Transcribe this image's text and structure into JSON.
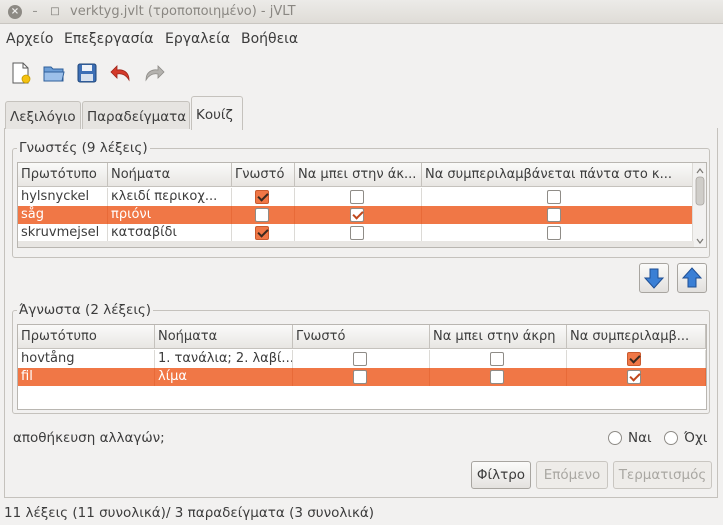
{
  "window": {
    "title": "verktyg.jvlt (τροποποιημένο) - jVLT",
    "close_glyph": "×",
    "min_glyph": "–",
    "max_glyph": "□"
  },
  "menu": {
    "items": [
      {
        "label": "Αρχείο"
      },
      {
        "label": "Επεξεργασία"
      },
      {
        "label": "Εργαλεία"
      },
      {
        "label": "Βοήθεια"
      }
    ]
  },
  "toolbar": {
    "icons": [
      "new-file-icon",
      "open-folder-icon",
      "save-icon",
      "undo-icon",
      "redo-icon"
    ]
  },
  "tabs": [
    {
      "label": "Λεξιλόγιο"
    },
    {
      "label": "Παραδείγματα"
    },
    {
      "label": "Κουίζ"
    }
  ],
  "known": {
    "label": "Γνωστές (9 λέξεις)",
    "columns": [
      "Πρωτότυπο",
      "Νοήματα",
      "Γνωστό",
      "Να μπει στην άκ...",
      "Να συμπεριλαμβάνεται πάντα στο κ..."
    ],
    "rows": [
      {
        "original": "hylsnyckel",
        "meaning": "κλειδί περικοχ...",
        "known": true,
        "edge": false,
        "always": false,
        "selected": false
      },
      {
        "original": "såg",
        "meaning": "πριόνι",
        "known": false,
        "edge": true,
        "always": false,
        "selected": true
      },
      {
        "original": "skruvmejsel",
        "meaning": "κατσαβίδι",
        "known": true,
        "edge": false,
        "always": false,
        "selected": false
      }
    ]
  },
  "unknown": {
    "label": "Άγνωστα (2 λέξεις)",
    "columns": [
      "Πρωτότυπο",
      "Νοήματα",
      "Γνωστό",
      "Να μπει στην άκρη",
      "Να συμπεριλαμβ..."
    ],
    "rows": [
      {
        "original": "hovtång",
        "meaning": "1. τανάλια; 2. λαβί...",
        "known": false,
        "edge": false,
        "always": true,
        "selected": false
      },
      {
        "original": "fil",
        "meaning": "λίμα",
        "known": false,
        "edge": false,
        "always": true,
        "selected": true
      }
    ]
  },
  "save": {
    "question": "αποθήκευση αλλαγών;",
    "yes": "Ναι",
    "no": "Όχι"
  },
  "buttons": {
    "filter": "Φίλτρο",
    "next": "Επόμενο",
    "finish": "Τερματισμός"
  },
  "status": "11 λέξεις (11 συνολικά)/ 3 παραδείγματα (3 συνολικά)",
  "colors": {
    "selection": "#f07746",
    "background": "#f2f1f0",
    "arrow_blue": "#3a7fd5"
  }
}
